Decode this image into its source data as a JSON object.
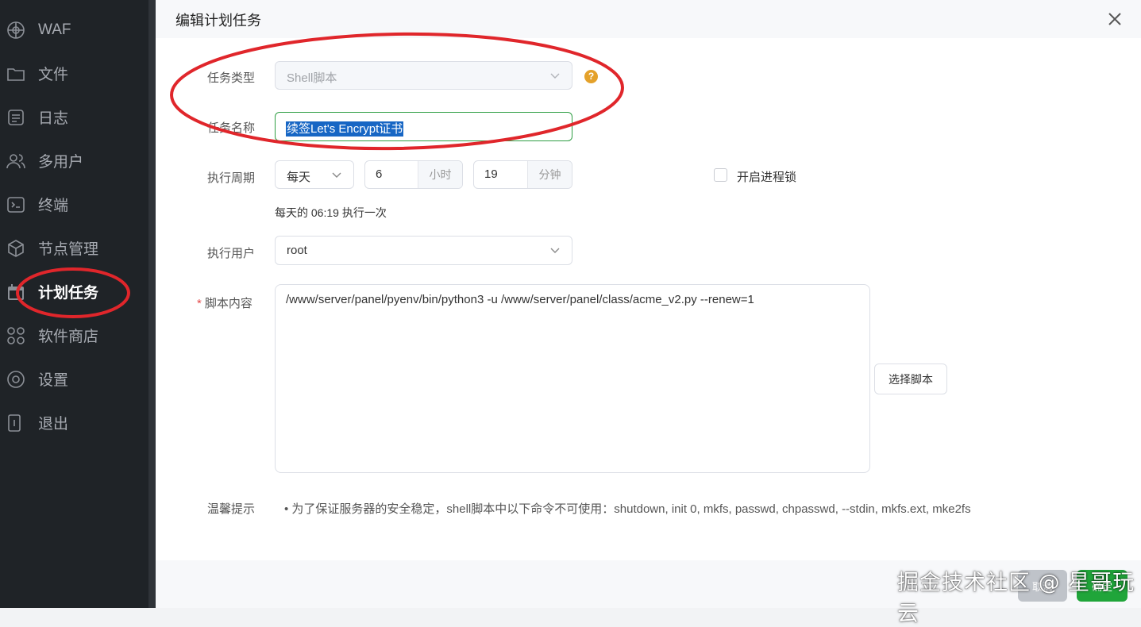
{
  "sidebar": {
    "items": [
      {
        "label": "WAF",
        "icon": "shield-icon"
      },
      {
        "label": "文件",
        "icon": "folder-icon"
      },
      {
        "label": "日志",
        "icon": "log-icon"
      },
      {
        "label": "多用户",
        "icon": "users-icon"
      },
      {
        "label": "终端",
        "icon": "terminal-icon"
      },
      {
        "label": "节点管理",
        "icon": "cube-icon"
      },
      {
        "label": "计划任务",
        "icon": "calendar-icon",
        "active": true
      },
      {
        "label": "软件商店",
        "icon": "apps-icon"
      },
      {
        "label": "设置",
        "icon": "settings-icon"
      },
      {
        "label": "退出",
        "icon": "logout-icon"
      }
    ]
  },
  "dialog": {
    "title": "编辑计划任务",
    "task_type": {
      "label": "任务类型",
      "value": "Shell脚本"
    },
    "task_name": {
      "label": "任务名称",
      "value": "续签Let's Encrypt证书"
    },
    "period": {
      "label": "执行周期",
      "frequency": "每天",
      "hour": "6",
      "hour_unit": "小时",
      "minute": "19",
      "minute_unit": "分钟",
      "lock_label": "开启进程锁",
      "lock_checked": false,
      "summary": "每天的 06:19 执行一次"
    },
    "user": {
      "label": "执行用户",
      "value": "root"
    },
    "script": {
      "required_mark": "*",
      "label": "脚本内容",
      "value": "/www/server/panel/pyenv/bin/python3 -u /www/server/panel/class/acme_v2.py --renew=1",
      "choose_button": "选择脚本"
    },
    "tips": {
      "label": "温馨提示",
      "text": "• 为了保证服务器的安全稳定，shell脚本中以下命令不可使用：shutdown, init 0, mkfs, passwd, chpasswd, --stdin, mkfs.ext, mke2fs"
    },
    "footer": {
      "cancel": "取消",
      "confirm": "确定"
    }
  },
  "watermark": "掘金技术社区 @ 星哥玩云",
  "colors": {
    "accent": "#20a53a",
    "annotation": "#e0262b",
    "sidebar_bg": "#1f2327"
  }
}
